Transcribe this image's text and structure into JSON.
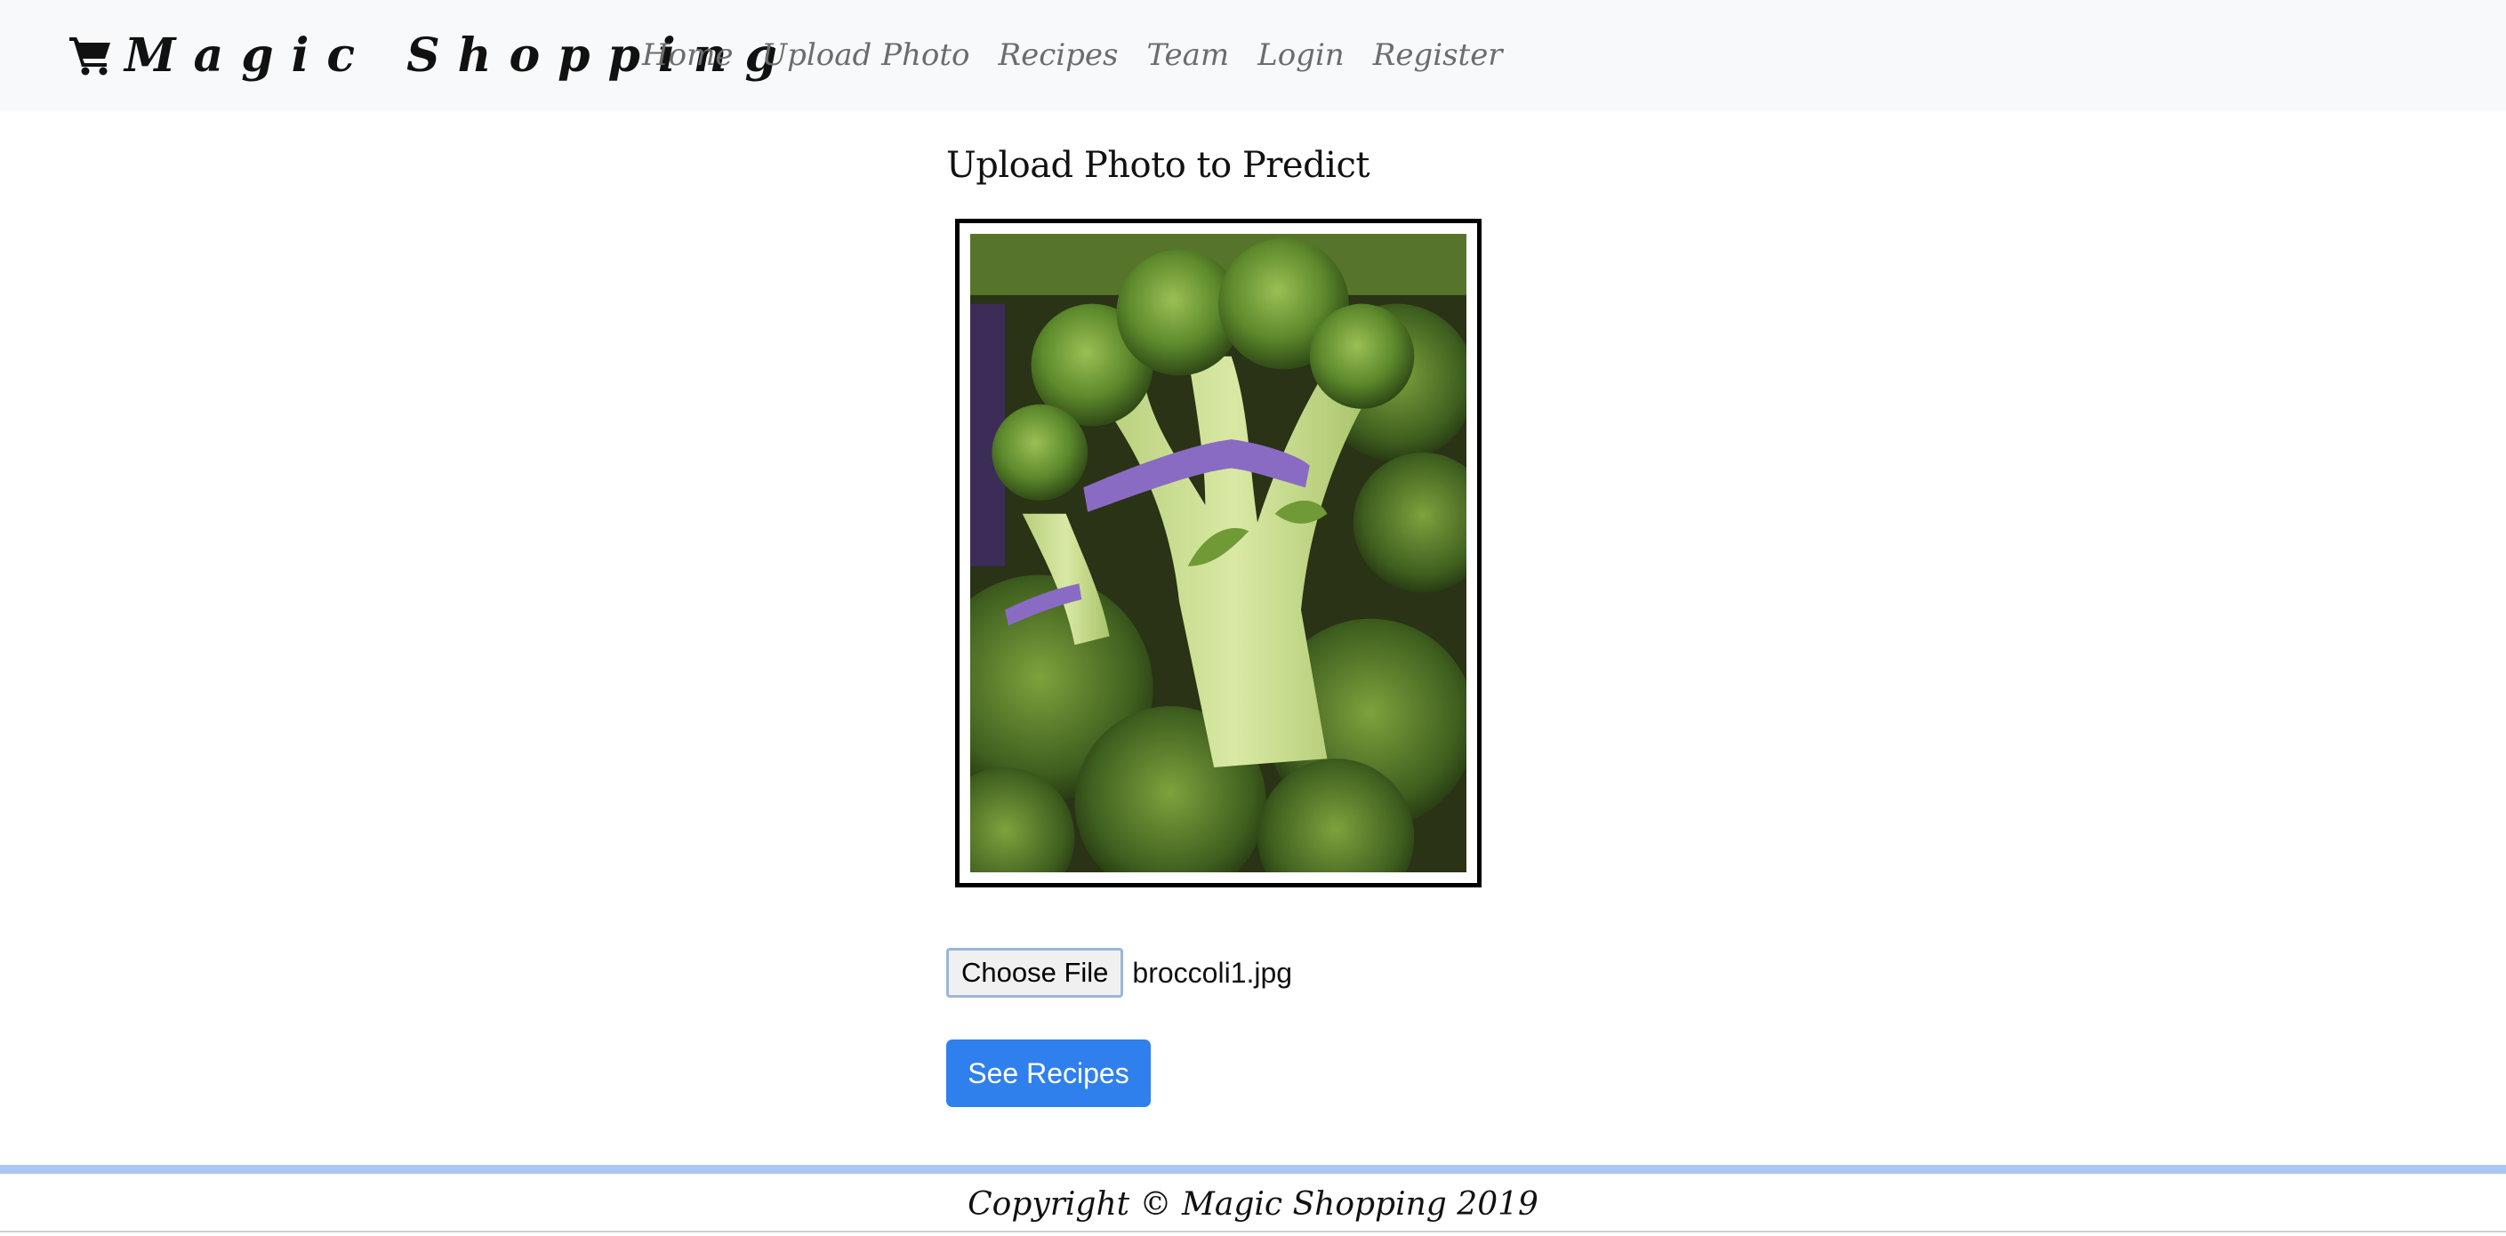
{
  "brand": {
    "name": "Magic Shopping",
    "icon": "shopping-cart-icon"
  },
  "nav": {
    "items": [
      {
        "label": "Home"
      },
      {
        "label": "Upload Photo"
      },
      {
        "label": "Recipes"
      },
      {
        "label": "Team"
      },
      {
        "label": "Login"
      },
      {
        "label": "Register"
      }
    ]
  },
  "main": {
    "title": "Upload Photo to Predict",
    "preview_image": "broccoli-photo",
    "file_input": {
      "button_label": "Choose File",
      "selected_file": "broccoli1.jpg"
    },
    "submit_label": "See Recipes"
  },
  "footer": {
    "text": "Copyright © Magic Shopping 2019"
  },
  "colors": {
    "navbar_bg": "#f8f9fa",
    "accent": "#2f80ed",
    "footer_bar": "#a9c6f4"
  }
}
